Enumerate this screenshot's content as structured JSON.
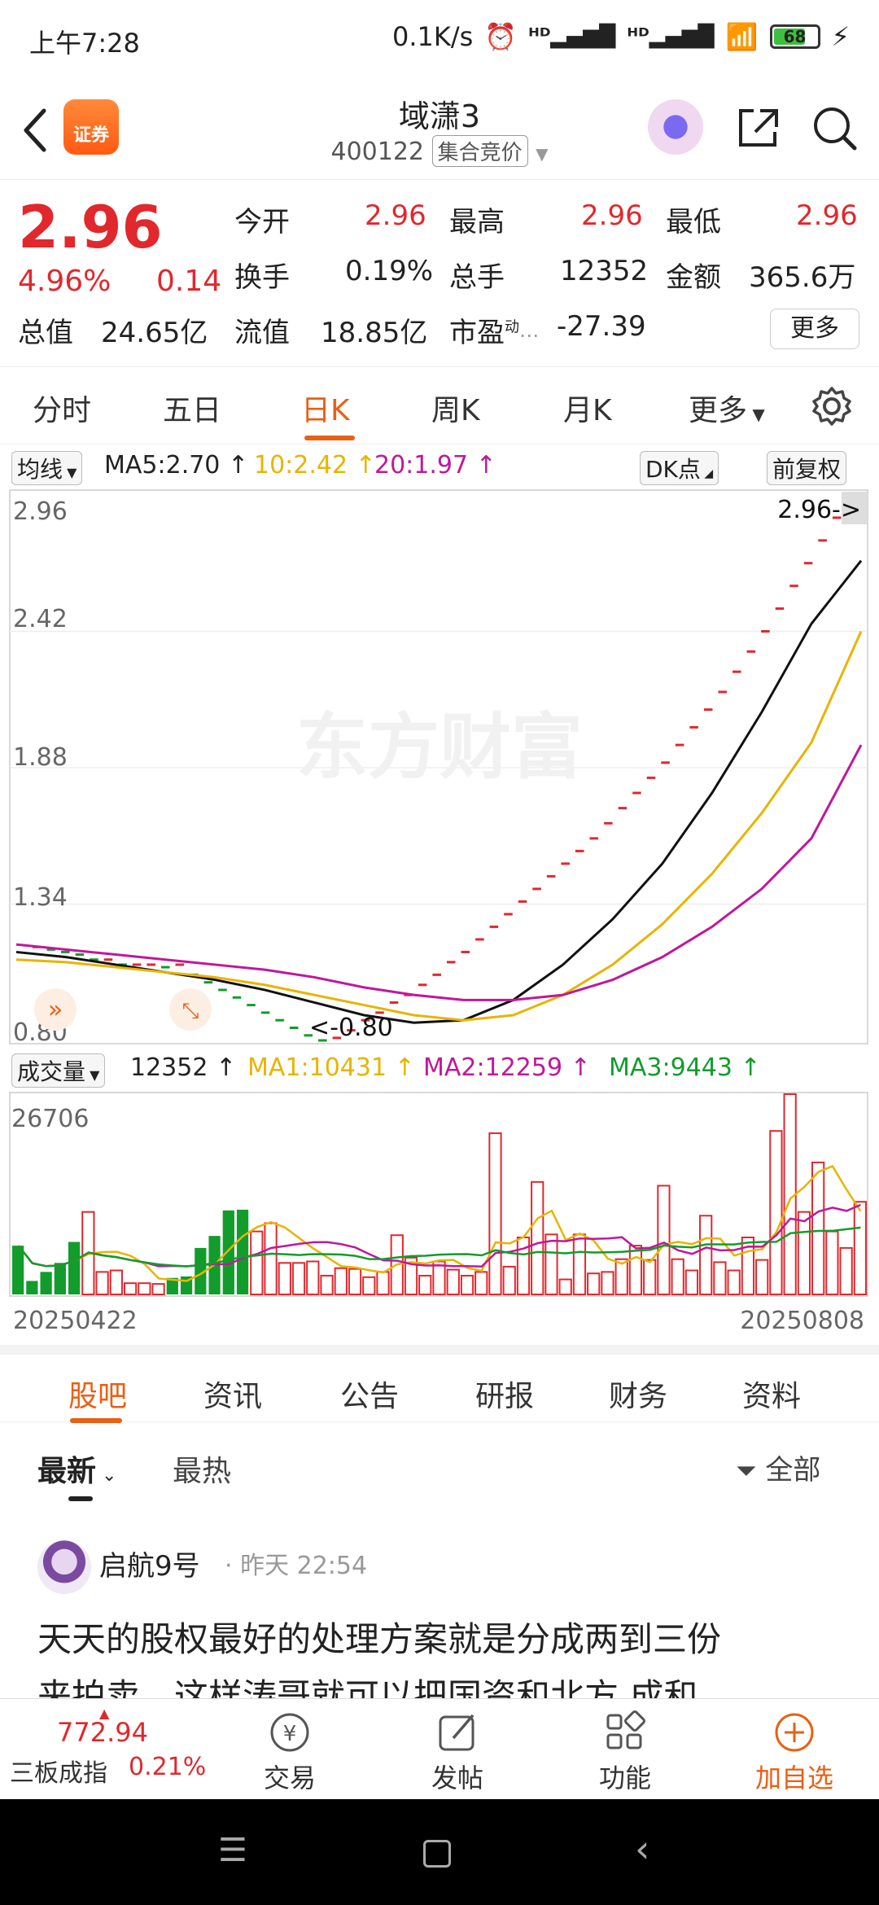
{
  "status": {
    "time": "上午7:28",
    "speed": "0.1K/s",
    "battery": "68"
  },
  "header": {
    "logo_text": "证券",
    "name": "域潇3",
    "code": "400122",
    "tag": "集合竞价"
  },
  "quote": {
    "price": "2.96",
    "pct": "4.96%",
    "change": "0.14",
    "open_label": "今开",
    "open": "2.96",
    "high_label": "最高",
    "high": "2.96",
    "low_label": "最低",
    "low": "2.96",
    "turnover_label": "换手",
    "turnover": "0.19%",
    "volume_label": "总手",
    "volume": "12352",
    "amount_label": "金额",
    "amount": "365.6万",
    "mktcap_label": "总值",
    "mktcap": "24.65亿",
    "float_label": "流值",
    "float": "18.85亿",
    "pe_label": "市盈",
    "pe_sup": "动",
    "pe": "-27.39",
    "more": "更多"
  },
  "tabs": [
    "分时",
    "五日",
    "日K",
    "周K",
    "月K",
    "更多"
  ],
  "ma_legend": {
    "selector": "均线",
    "ma5": "MA5:2.70",
    "ma10": "10:2.42",
    "ma20": "20:1.97",
    "dk": "DK点",
    "adj": "前复权"
  },
  "kline_axis": {
    "p1": "2.96",
    "p2": "2.42",
    "p3": "1.88",
    "p4": "1.34",
    "p5": "0.80",
    "last": "2.96->",
    "low_mark": "<-0.80",
    "watermark": "东方财富"
  },
  "vol_legend": {
    "selector": "成交量",
    "vol": "12352",
    "ma1": "MA1:10431",
    "ma2": "MA2:12259",
    "ma3": "MA3:9443"
  },
  "vol_axis": {
    "top": "26706",
    "start": "20250422",
    "end": "20250808"
  },
  "content_tabs": [
    "股吧",
    "资讯",
    "公告",
    "研报",
    "财务",
    "资料"
  ],
  "sub_tabs": {
    "latest": "最新",
    "hot": "最热",
    "filter": "全部"
  },
  "post": {
    "user": "启航9号",
    "time": "昨天 22:54",
    "line1": "天天的股权最好的处理方案就是分成两到三份",
    "line2": "来拍卖，这样涛哥就可以把国资和北方 成和"
  },
  "toolbar": {
    "index_value": "772.94",
    "index_name": "三板成指",
    "index_pct": "0.21%",
    "trade": "交易",
    "post": "发帖",
    "func": "功能",
    "add": "加自选"
  },
  "colors": {
    "up": "#e0282d",
    "down": "#129c2c",
    "accent": "#e95f14",
    "ma10": "#e8b400",
    "ma20": "#c0189a"
  },
  "chart_data": [
    {
      "type": "line",
      "title": "",
      "ylim": [
        0.8,
        2.96
      ],
      "x_start": "20250422",
      "x_end": "20250808",
      "daily_close": [
        1.17,
        1.16,
        1.15,
        1.14,
        1.12,
        1.12,
        1.1,
        1.1,
        1.1,
        1.09,
        1.1,
        1.06,
        1.03,
        1.0,
        0.97,
        0.94,
        0.91,
        0.88,
        0.85,
        0.82,
        0.8,
        0.81,
        0.84,
        0.88,
        0.91,
        0.95,
        0.98,
        1.02,
        1.06,
        1.11,
        1.15,
        1.2,
        1.25,
        1.3,
        1.35,
        1.4,
        1.45,
        1.5,
        1.55,
        1.6,
        1.66,
        1.72,
        1.78,
        1.84,
        1.9,
        1.97,
        2.04,
        2.11,
        2.18,
        2.26,
        2.34,
        2.42,
        2.51,
        2.6,
        2.69,
        2.78,
        2.87,
        2.96
      ],
      "series": [
        {
          "name": "MA5",
          "values": [
            1.15,
            1.13,
            1.1,
            1.07,
            1.04,
            1.0,
            0.95,
            0.9,
            0.87,
            0.88,
            0.96,
            1.1,
            1.28,
            1.5,
            1.78,
            2.1,
            2.45,
            2.7
          ]
        },
        {
          "name": "MA10",
          "values": [
            1.12,
            1.11,
            1.09,
            1.07,
            1.05,
            1.02,
            0.98,
            0.94,
            0.9,
            0.88,
            0.9,
            0.98,
            1.1,
            1.26,
            1.46,
            1.7,
            1.98,
            2.42
          ]
        },
        {
          "name": "MA20",
          "values": [
            1.18,
            1.16,
            1.14,
            1.12,
            1.1,
            1.08,
            1.05,
            1.01,
            0.98,
            0.96,
            0.96,
            0.98,
            1.04,
            1.13,
            1.25,
            1.4,
            1.6,
            1.97
          ]
        }
      ]
    },
    {
      "type": "bar",
      "title": "",
      "ylim": [
        0,
        26706
      ],
      "volume_up": [
        true,
        true,
        true,
        true,
        true,
        false,
        false,
        false,
        false,
        false,
        false,
        true,
        true,
        true,
        true,
        true,
        true,
        false,
        false,
        false,
        false,
        true,
        false,
        false,
        false,
        false,
        false,
        false,
        false,
        false,
        false,
        false,
        false,
        false,
        false,
        false,
        false,
        false,
        false,
        false,
        false,
        false,
        false,
        false,
        false,
        false,
        false,
        false
      ],
      "volume": [
        6500,
        1800,
        3000,
        4200,
        7000,
        11000,
        3000,
        3200,
        1500,
        1500,
        1400,
        2200,
        2400,
        6200,
        7800,
        11200,
        11300,
        8400,
        9500,
        4200,
        4200,
        4400,
        2500,
        3500,
        3400,
        2300,
        3000,
        7900,
        4900,
        2500,
        4400,
        3300,
        2500,
        3000,
        21500,
        3700,
        7600,
        15000,
        8000,
        2000,
        8000,
        2800,
        3000,
        4700,
        6500,
        4600,
        14500,
        4700,
        3200,
        10500,
        4300,
        3200,
        7600,
        4600,
        21800,
        26706,
        11000,
        17600,
        8400,
        6200,
        12352
      ]
    }
  ]
}
